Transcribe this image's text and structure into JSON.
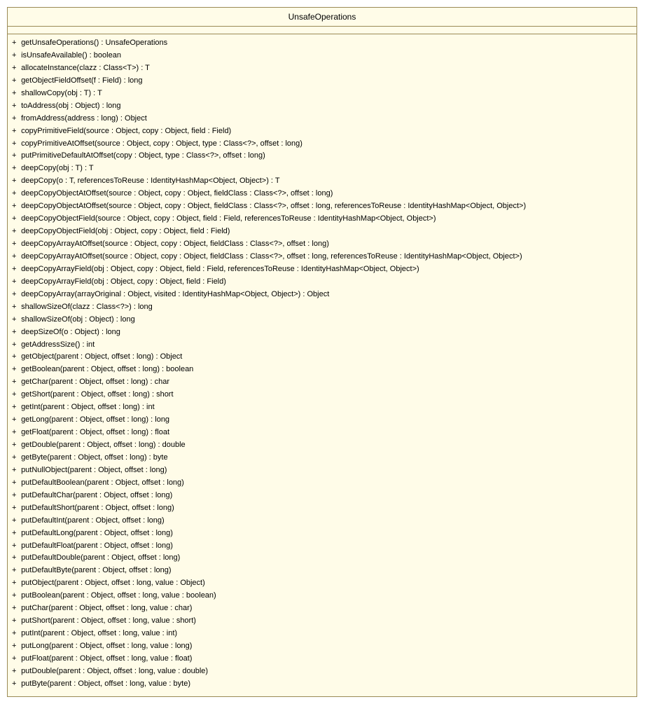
{
  "className": "UnsafeOperations",
  "visibility": "+",
  "methods": [
    "getUnsafeOperations() : UnsafeOperations",
    "isUnsafeAvailable() : boolean",
    "allocateInstance(clazz : Class<T>) : T",
    "getObjectFieldOffset(f : Field) : long",
    "shallowCopy(obj : T) : T",
    "toAddress(obj : Object) : long",
    "fromAddress(address : long) : Object",
    "copyPrimitiveField(source : Object, copy : Object, field : Field)",
    "copyPrimitiveAtOffset(source : Object, copy : Object, type : Class<?>, offset : long)",
    "putPrimitiveDefaultAtOffset(copy : Object, type : Class<?>, offset : long)",
    "deepCopy(obj : T) : T",
    "deepCopy(o : T, referencesToReuse : IdentityHashMap<Object, Object>) : T",
    "deepCopyObjectAtOffset(source : Object, copy : Object, fieldClass : Class<?>, offset : long)",
    "deepCopyObjectAtOffset(source : Object, copy : Object, fieldClass : Class<?>, offset : long, referencesToReuse : IdentityHashMap<Object, Object>)",
    "deepCopyObjectField(source : Object, copy : Object, field : Field, referencesToReuse : IdentityHashMap<Object, Object>)",
    "deepCopyObjectField(obj : Object, copy : Object, field : Field)",
    "deepCopyArrayAtOffset(source : Object, copy : Object, fieldClass : Class<?>, offset : long)",
    "deepCopyArrayAtOffset(source : Object, copy : Object, fieldClass : Class<?>, offset : long, referencesToReuse : IdentityHashMap<Object, Object>)",
    "deepCopyArrayField(obj : Object, copy : Object, field : Field, referencesToReuse : IdentityHashMap<Object, Object>)",
    "deepCopyArrayField(obj : Object, copy : Object, field : Field)",
    "deepCopyArray(arrayOriginal : Object, visited : IdentityHashMap<Object, Object>) : Object",
    "shallowSizeOf(clazz : Class<?>) : long",
    "shallowSizeOf(obj : Object) : long",
    "deepSizeOf(o : Object) : long",
    "getAddressSize() : int",
    "getObject(parent : Object, offset : long) : Object",
    "getBoolean(parent : Object, offset : long) : boolean",
    "getChar(parent : Object, offset : long) : char",
    "getShort(parent : Object, offset : long) : short",
    "getInt(parent : Object, offset : long) : int",
    "getLong(parent : Object, offset : long) : long",
    "getFloat(parent : Object, offset : long) : float",
    "getDouble(parent : Object, offset : long) : double",
    "getByte(parent : Object, offset : long) : byte",
    "putNullObject(parent : Object, offset : long)",
    "putDefaultBoolean(parent : Object, offset : long)",
    "putDefaultChar(parent : Object, offset : long)",
    "putDefaultShort(parent : Object, offset : long)",
    "putDefaultInt(parent : Object, offset : long)",
    "putDefaultLong(parent : Object, offset : long)",
    "putDefaultFloat(parent : Object, offset : long)",
    "putDefaultDouble(parent : Object, offset : long)",
    "putDefaultByte(parent : Object, offset : long)",
    "putObject(parent : Object, offset : long, value : Object)",
    "putBoolean(parent : Object, offset : long, value : boolean)",
    "putChar(parent : Object, offset : long, value : char)",
    "putShort(parent : Object, offset : long, value : short)",
    "putInt(parent : Object, offset : long, value : int)",
    "putLong(parent : Object, offset : long, value : long)",
    "putFloat(parent : Object, offset : long, value : float)",
    "putDouble(parent : Object, offset : long, value : double)",
    "putByte(parent : Object, offset : long, value : byte)"
  ]
}
